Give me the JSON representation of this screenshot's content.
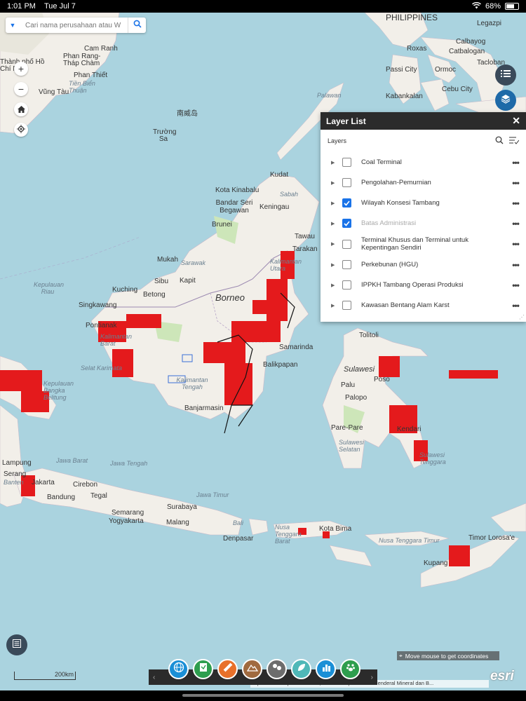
{
  "status_bar": {
    "time": "1:01 PM",
    "date": "Tue Jul 7",
    "battery": "68%"
  },
  "search": {
    "placeholder": "Cari nama perusahaan atau W"
  },
  "map": {
    "labels": {
      "philippines": "PHILIPPINES",
      "roxas": "Roxas",
      "calbayog": "Calbayog",
      "catbalogan": "Catbalogan",
      "passi": "Passi City",
      "ormoc": "Ormoc",
      "tacloban": "Tacloban",
      "kabankalan": "Kabankalan",
      "cebu": "Cebu City",
      "legazpi": "Legazpi",
      "cam_ranh": "Cam Ranh",
      "phan_rang": "Phan Rang-Tháp Chàm",
      "phan_thiet": "Phan Thiết",
      "hcm": "Thành phố Hồ Chí Minh",
      "vung_tau": "Vũng Tàu",
      "tien_bien": "Tiền Biển Thuận",
      "nanwei": "南威岛",
      "truong_sa": "Trường Sa",
      "palawan": "Palawan",
      "kudat": "Kudat",
      "kota_kinabalu": "Kota Kinabalu",
      "sabah": "Sabah",
      "bandar": "Bandar Seri Begawan",
      "keningau": "Keningau",
      "brunei": "Brunei",
      "tawau": "Tawau",
      "tarakan": "Tarakan",
      "mukah": "Mukah",
      "sarawak": "Sarawak",
      "sibu": "Sibu",
      "kapit": "Kapit",
      "kalimantan_utara": "Kalimantan Utara",
      "kuching": "Kuching",
      "betong": "Betong",
      "borneo": "Borneo",
      "kepulauan_riau": "Kepulauan Riau",
      "singkawang": "Singkawang",
      "pontianak": "Pontianak",
      "kalimantan_barat": "Kalimantan Barat",
      "samarinda": "Samarinda",
      "balikpapan": "Balikpapan",
      "kalimantan_tengah": "Kalimantan Tengah",
      "banjarmasin": "Banjarmasin",
      "selat_karimata": "Selat Karimata",
      "kepulauan_bangka": "Kepulauan Bangka Belitung",
      "tolitoli": "Tolitoli",
      "sulawesi": "Sulawesi",
      "poso": "Poso",
      "palu": "Palu",
      "palopo": "Palopo",
      "pare_pare": "Pare-Pare",
      "kendari": "Kendari",
      "sulawesi_selatan": "Sulawesi Selatan",
      "sulawesi_tenggara": "Sulawesi Tenggara",
      "lampung": "Lampung",
      "serang": "Serang",
      "banten": "Banten",
      "jakarta": "Jakarta",
      "jawa_barat": "Jawa Barat",
      "jawa_tengah": "Jawa Tengah",
      "cirebon": "Cirebon",
      "bandung": "Bandung",
      "tegal": "Tegal",
      "semarang": "Semarang",
      "surabaya": "Surabaya",
      "yogyakarta": "Yogyakarta",
      "malang": "Malang",
      "jawa_timur": "Jawa Timur",
      "bali": "Bali",
      "denpasar": "Denpasar",
      "ntb": "Nusa Tenggara Barat",
      "kota_bima": "Kota Bima",
      "ntt": "Nusa Tenggara Timur",
      "timor_lorosae": "Timor Lorosa'e",
      "kupang": "Kupang"
    }
  },
  "layer_list": {
    "title": "Layer List",
    "section_label": "Layers",
    "layers": [
      {
        "label": "Coal Terminal",
        "checked": false
      },
      {
        "label": "Pengolahan-Pemurnian",
        "checked": false
      },
      {
        "label": "Wilayah Konsesi Tambang",
        "checked": true
      },
      {
        "label": "Batas Administrasi",
        "checked": true
      },
      {
        "label": "Terminal Khusus dan Terminal untuk Kepentingan Sendiri",
        "checked": false
      },
      {
        "label": "Perkebunan (HGU)",
        "checked": false
      },
      {
        "label": "IPPKH Tambang Operasi Produksi",
        "checked": false
      },
      {
        "label": "Kawasan Bentang Alam Karst",
        "checked": false
      }
    ]
  },
  "coordinates": {
    "text": "Move mouse to get coordinates"
  },
  "scale": {
    "label": "200km"
  },
  "attribution": {
    "text": "OpenStreetMap contributors, CC-BY-SA | Direktorat Jenderal Mineral dan B..."
  },
  "brand": {
    "esri": "esri"
  },
  "toolbar_icons": [
    {
      "name": "globe-icon",
      "color": "#1a8fd6"
    },
    {
      "name": "document-icon",
      "color": "#2e9e4e"
    },
    {
      "name": "ruler-icon",
      "color": "#e8702a"
    },
    {
      "name": "mountain-icon",
      "color": "#a06a3f"
    },
    {
      "name": "layers-people-icon",
      "color": "#6d6d6d"
    },
    {
      "name": "leaf-icon",
      "color": "#4fb8b8"
    },
    {
      "name": "chart-icon",
      "color": "#1a8fd6"
    },
    {
      "name": "paw-icon",
      "color": "#2e9e4e"
    }
  ],
  "colors": {
    "water": "#aad3df",
    "land": "#f2efe9",
    "concession": "#e41a1c",
    "panel_header": "#2b2b2b",
    "accent": "#1a73e8"
  }
}
